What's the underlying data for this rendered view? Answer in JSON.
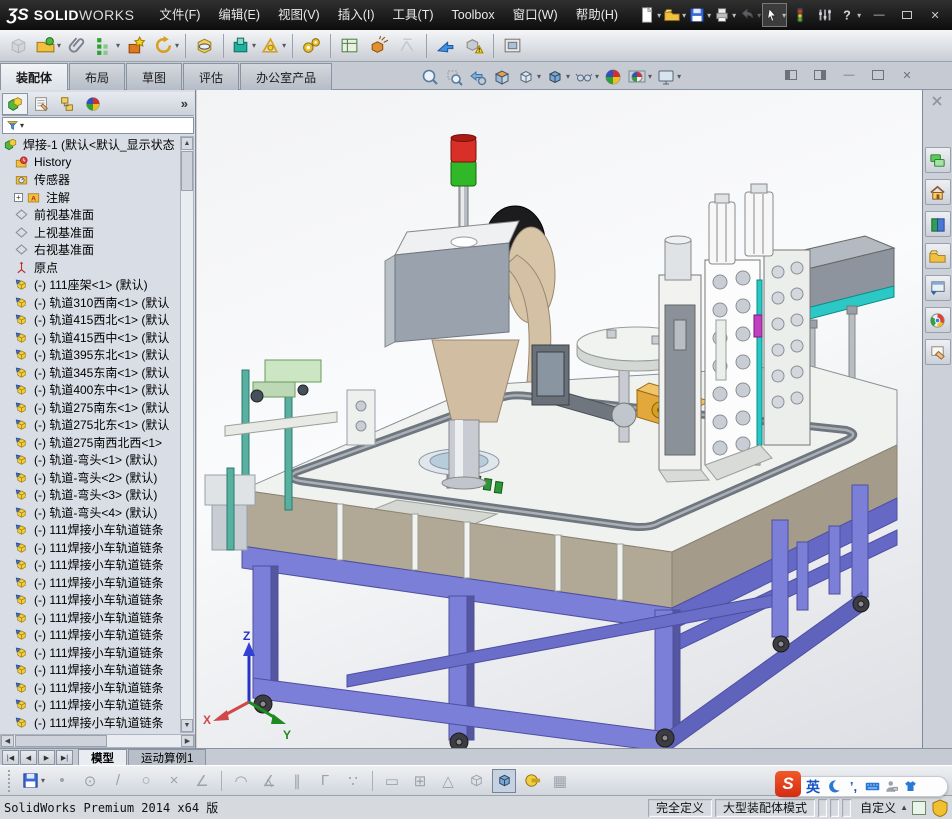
{
  "titlebar": {
    "logo_mark": "ƷS",
    "logo_solid": "SOLID",
    "logo_works": "WORKS",
    "menus": [
      "文件(F)",
      "编辑(E)",
      "视图(V)",
      "插入(I)",
      "工具(T)",
      "Toolbox",
      "窗口(W)",
      "帮助(H)"
    ],
    "window_buttons": [
      "minimize",
      "restore",
      "close"
    ]
  },
  "quick_toolbar": [
    {
      "icon": "page",
      "dd": true
    },
    {
      "icon": "folder-open",
      "dd": true
    },
    {
      "icon": "floppy",
      "dd": true
    },
    {
      "icon": "printer",
      "dd": true
    },
    {
      "icon": "undo",
      "dd": true,
      "disabled": true
    },
    {
      "icon": "cursor",
      "dd": true,
      "pressed": true
    },
    {
      "icon": "traffic"
    },
    {
      "icon": "options"
    },
    {
      "icon": "help",
      "dd": true
    }
  ],
  "main_toolbar": [
    {
      "icon": "insert-component",
      "disabled": true
    },
    {
      "icon": "open-part",
      "dd": true
    },
    {
      "icon": "mate"
    },
    {
      "icon": "linear-pattern",
      "dd": true
    },
    {
      "icon": "smart-fasteners"
    },
    {
      "icon": "move-component",
      "dd": true
    },
    {
      "sep": true
    },
    {
      "icon": "show-hidden"
    },
    {
      "sep": true
    },
    {
      "icon": "assembly-features",
      "dd": true
    },
    {
      "icon": "reference-geometry",
      "dd": true
    },
    {
      "sep": true
    },
    {
      "icon": "motion-study"
    },
    {
      "sep": true
    },
    {
      "icon": "bom"
    },
    {
      "icon": "exploded-view"
    },
    {
      "icon": "explode-sketch",
      "disabled": true
    },
    {
      "sep": true
    },
    {
      "icon": "instant3d"
    },
    {
      "icon": "large-assembly"
    },
    {
      "sep": true
    },
    {
      "icon": "snapshot"
    }
  ],
  "command_tabs": {
    "items": [
      "装配体",
      "布局",
      "草图",
      "评估",
      "办公室产品"
    ],
    "active_index": 0
  },
  "headsup": [
    {
      "icon": "zoom-fit"
    },
    {
      "icon": "zoom-area"
    },
    {
      "icon": "previous-view"
    },
    {
      "icon": "section-view"
    },
    {
      "icon": "view-orientation",
      "dd": true
    },
    {
      "icon": "display-style",
      "dd": true
    },
    {
      "icon": "hide-show",
      "dd": true
    },
    {
      "icon": "appearance"
    },
    {
      "icon": "scene",
      "dd": true
    },
    {
      "icon": "view-settings",
      "dd": true
    }
  ],
  "child_window_controls": [
    "pane-left",
    "pane-right",
    "minimize",
    "restore",
    "close"
  ],
  "feature_panel": {
    "tabs": [
      "featuremanager",
      "propertymanager",
      "configurationmanager",
      "displaymanager"
    ],
    "overflow_label": "»",
    "root_label": "焊接-1 (默认<默认_显示状态",
    "items": [
      {
        "icon": "history",
        "label": "History"
      },
      {
        "icon": "sensors",
        "label": "传感器"
      },
      {
        "icon": "annotations",
        "label": "注解",
        "expandable": true
      },
      {
        "icon": "plane",
        "label": "前视基准面"
      },
      {
        "icon": "plane",
        "label": "上视基准面"
      },
      {
        "icon": "plane",
        "label": "右视基准面"
      },
      {
        "icon": "origin",
        "label": "原点"
      },
      {
        "icon": "component",
        "label": "(-) 111座架<1> (默认)"
      },
      {
        "icon": "component",
        "label": "(-) 轨道310西南<1> (默认"
      },
      {
        "icon": "component",
        "label": "(-) 轨道415西北<1> (默认"
      },
      {
        "icon": "component",
        "label": "(-) 轨道415西中<1> (默认"
      },
      {
        "icon": "component",
        "label": "(-) 轨道395东北<1> (默认"
      },
      {
        "icon": "component",
        "label": "(-) 轨道345东南<1> (默认"
      },
      {
        "icon": "component",
        "label": "(-) 轨道400东中<1> (默认"
      },
      {
        "icon": "component",
        "label": "(-) 轨道275南东<1> (默认"
      },
      {
        "icon": "component",
        "label": "(-) 轨道275北东<1> (默认"
      },
      {
        "icon": "component",
        "label": "(-) 轨道275南西北西<1>"
      },
      {
        "icon": "component",
        "label": "(-) 轨道-弯头<1> (默认)"
      },
      {
        "icon": "component",
        "label": "(-) 轨道-弯头<2> (默认)"
      },
      {
        "icon": "component",
        "label": "(-) 轨道-弯头<3> (默认)"
      },
      {
        "icon": "component",
        "label": "(-) 轨道-弯头<4> (默认)"
      },
      {
        "icon": "component",
        "label": "(-) 111焊接小车轨道链条"
      },
      {
        "icon": "component",
        "label": "(-) 111焊接小车轨道链条"
      },
      {
        "icon": "component",
        "label": "(-) 111焊接小车轨道链条"
      },
      {
        "icon": "component",
        "label": "(-) 111焊接小车轨道链条"
      },
      {
        "icon": "component",
        "label": "(-) 111焊接小车轨道链条"
      },
      {
        "icon": "component",
        "label": "(-) 111焊接小车轨道链条"
      },
      {
        "icon": "component",
        "label": "(-) 111焊接小车轨道链条"
      },
      {
        "icon": "component",
        "label": "(-) 111焊接小车轨道链条"
      },
      {
        "icon": "component",
        "label": "(-) 111焊接小车轨道链条"
      },
      {
        "icon": "component",
        "label": "(-) 111焊接小车轨道链条"
      },
      {
        "icon": "component",
        "label": "(-) 111焊接小车轨道链条"
      },
      {
        "icon": "component",
        "label": "(-) 111焊接小车轨道链条"
      }
    ]
  },
  "task_pane": {
    "tabs": [
      "comments",
      "home",
      "content",
      "library",
      "explorer",
      "internet",
      "appearances-pane"
    ]
  },
  "viewport": {
    "triad": {
      "x": "X",
      "y": "Y",
      "z": "Z"
    }
  },
  "model_tabs": {
    "nav": [
      "first",
      "prev",
      "next",
      "last"
    ],
    "items": [
      "模型",
      "运动算例1"
    ],
    "active_index": 0
  },
  "bottom_toolbar": [
    {
      "icon": "floppy",
      "dd": true,
      "name": "save"
    },
    {
      "glyph": "•",
      "name": "point-tool"
    },
    {
      "glyph": "⊙",
      "name": "circle-tool"
    },
    {
      "glyph": "/",
      "name": "line-tool"
    },
    {
      "glyph": "○",
      "name": "polygon-tool"
    },
    {
      "glyph": "×",
      "name": "trim-tool"
    },
    {
      "glyph": "∠",
      "name": "angle-tool"
    },
    {
      "sep": true
    },
    {
      "glyph": "◠",
      "name": "arc-tool"
    },
    {
      "glyph": "∡",
      "name": "fillet-tool"
    },
    {
      "glyph": "∥",
      "name": "parallel-tool"
    },
    {
      "glyph": "Γ",
      "name": "corner-tool"
    },
    {
      "glyph": "∵",
      "name": "points-tool"
    },
    {
      "sep": true
    },
    {
      "glyph": "▭",
      "name": "dimension-tool"
    },
    {
      "glyph": "⊞",
      "name": "grid-tool"
    },
    {
      "glyph": "△",
      "name": "triangle-tool"
    },
    {
      "icon": "wire-cube",
      "name": "wireframe-view"
    },
    {
      "icon": "shaded-cube",
      "active": true,
      "name": "shaded-view"
    },
    {
      "icon": "measure",
      "name": "measure-tool"
    },
    {
      "glyph": "▦",
      "name": "table-tool"
    }
  ],
  "status_bar": {
    "left_text": "SolidWorks Premium 2014 x64 版",
    "defined_state": "完全定义",
    "mode": "大型装配体模式",
    "custom_label": "自定义"
  },
  "ime": {
    "logo_letter": "S",
    "lang_label": "英",
    "icons": [
      "moon",
      "punct",
      "keyboard",
      "person",
      "skin"
    ],
    "punct_text": "’,"
  },
  "colors": {
    "frame_purple": "#7b7fd8",
    "tower_light_red": "#d83028",
    "tower_light_green": "#30b828",
    "cyan_plate": "#2cc8c6",
    "orange_box": "#e2a83c",
    "titlebar_bg": "#141414",
    "accent_red": "#cc1f1f"
  }
}
